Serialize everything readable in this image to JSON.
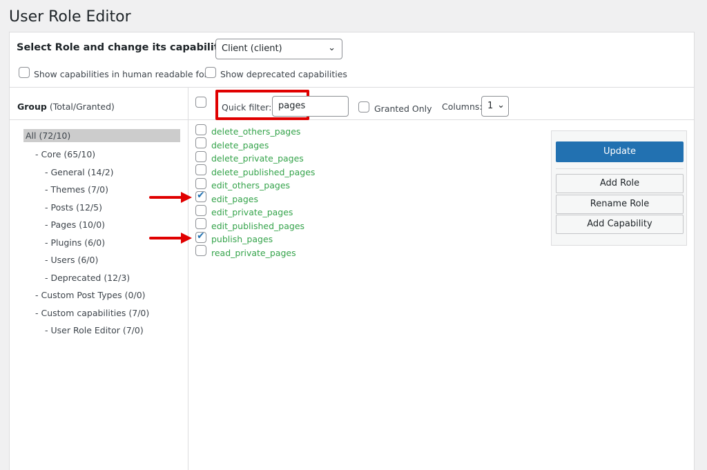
{
  "page_title": "User Role Editor",
  "role": {
    "label": "Select Role and change its capabilities:",
    "selected": "Client (client)"
  },
  "options": {
    "human_readable": "Show capabilities in human readable form",
    "deprecated": "Show deprecated capabilities"
  },
  "group": {
    "header_bold": "Group",
    "header_rest": " (Total/Granted)",
    "items": [
      "All (72/10)",
      "- Core (65/10)",
      "- General (14/2)",
      "- Themes (7/0)",
      "- Posts (12/5)",
      "- Pages (10/0)",
      "- Plugins (6/0)",
      "- Users (6/0)",
      "- Deprecated (12/3)",
      "- Custom Post Types (0/0)",
      "- Custom capabilities (7/0)",
      "- User Role Editor (7/0)"
    ]
  },
  "filter": {
    "label": "Quick filter:",
    "value": "pages",
    "granted_only": "Granted Only",
    "columns_label": "Columns:",
    "columns_value": "1"
  },
  "capabilities": [
    {
      "name": "delete_others_pages",
      "checked": false
    },
    {
      "name": "delete_pages",
      "checked": false
    },
    {
      "name": "delete_private_pages",
      "checked": false
    },
    {
      "name": "delete_published_pages",
      "checked": false
    },
    {
      "name": "edit_others_pages",
      "checked": false
    },
    {
      "name": "edit_pages",
      "checked": true
    },
    {
      "name": "edit_private_pages",
      "checked": false
    },
    {
      "name": "edit_published_pages",
      "checked": false
    },
    {
      "name": "publish_pages",
      "checked": true
    },
    {
      "name": "read_private_pages",
      "checked": false
    }
  ],
  "actions": {
    "update": "Update",
    "add_role": "Add Role",
    "rename_role": "Rename Role",
    "add_capability": "Add Capability"
  },
  "colors": {
    "capability_text": "#34a34a",
    "primary_button": "#2271b1",
    "highlight": "#e00000"
  }
}
